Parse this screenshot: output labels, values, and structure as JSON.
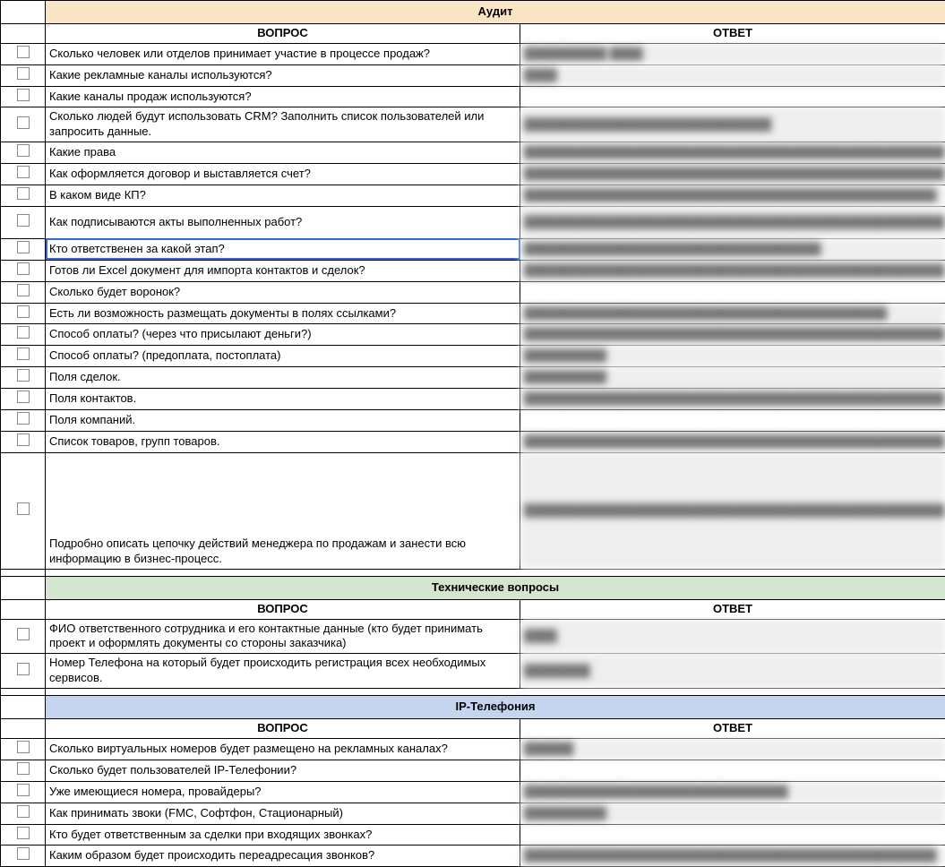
{
  "sections": [
    {
      "title": "Аудит",
      "headerClass": "sec-audit",
      "question_label": "ВОПРОС",
      "answer_label": "ОТВЕТ",
      "rows": [
        {
          "q": "Сколько человек или отделов принимает участие в процессе продаж?",
          "a": "██████████ ████"
        },
        {
          "q": "Какие рекламные каналы используются?",
          "a": "████"
        },
        {
          "q": "Какие каналы продаж используются?",
          "a": ""
        },
        {
          "q": "Сколько людей будут использовать CRM? Заполнить список пользователей или запросить данные.",
          "a": "██████████████████████████████"
        },
        {
          "q": "Какие права",
          "a": "████████████████████████████████████████████████████"
        },
        {
          "q": "Как оформляется договор и выставляется счет?",
          "a": "████████████████████████████████████████████████████████████"
        },
        {
          "q": "В каком виде КП?",
          "a": "██████████████████████████████████████████████████"
        },
        {
          "q": "Как подписываются акты выполненных работ?",
          "a": "██████████████████████████████████████████████████████████████████████████████████████████████████████████████",
          "tall": true
        },
        {
          "q": "Кто ответственен за какой этап?",
          "a": "████████████████████████████████████",
          "selected": true
        },
        {
          "q": "Готов ли Excel документ для импорта контактов и сделок?",
          "a": "████████████████████████████████████████████████████████████"
        },
        {
          "q": "Сколько будет воронок?",
          "a": ""
        },
        {
          "q": "Есть ли возможность размещать документы в полях ссылками?",
          "a": "████████████████████████████████████████████"
        },
        {
          "q": "Способ оплаты? (через что присылают деньги?)",
          "a": "████████████████████████████████████████████████████████████████████████████████"
        },
        {
          "q": "Способ оплаты? (предоплата, постоплата)",
          "a": "██████████"
        },
        {
          "q": "Поля сделок.",
          "a": "██████████"
        },
        {
          "q": "Поля контактов.",
          "a": "██████████████████████████████████████████████████████████████████████████████████████████████████████████████████████████████"
        },
        {
          "q": "Поля компаний.",
          "a": ""
        },
        {
          "q": "Список товаров, групп товаров.",
          "a": "████████████████████████████████████████████████████████████████████████████████████████████████████████████████████████████████████████████████████████████████████████████"
        },
        {
          "q": "Подробно описать цепочку действий менеджера по продажам и занести всю информацию в бизнес-процесс.",
          "a": "████████████████████████████████████████████████████████████████████████████████████████████████████████████████████████████████████████████████████████████████████████████████████████████████████████████████████████████████████████████████████████████████████████████████████████████████████████████████████████████████████████████████████████████████████████████████████████████████████████████████████████████████████████████████████████████████████████████████████████████████████████████████████████████████████████████████████████████████████████████████████████████████████████████████████████████████████████████████████████████████████████████████████████████████████████████████████████████████████████████████████████████████████████████████████████████████████████████████████████████████████████████████████████████████████████████████████████████████████████████████████████████████████████████████████████████████████████████████████████████████████████████████████████████████████████████████████████████████████████████████████████████████",
          "verytall": true
        }
      ]
    },
    {
      "title": "Технические вопросы",
      "headerClass": "sec-tech",
      "question_label": "ВОПРОС",
      "answer_label": "ОТВЕТ",
      "rows": [
        {
          "q": "ФИО ответственного сотрудника и его контактные данные (кто будет принимать проект и оформлять документы со стороны заказчика)",
          "a": "████"
        },
        {
          "q": "Номер Телефона на который будет происходить регистрация всех необходимых сервисов.",
          "a": "████████"
        }
      ]
    },
    {
      "title": "IP-Телефония",
      "headerClass": "sec-ip",
      "question_label": "ВОПРОС",
      "answer_label": "ОТВЕТ",
      "rows": [
        {
          "q": "Сколько виртуальных номеров будет размещено на рекламных каналах?",
          "a": "██████"
        },
        {
          "q": "Сколько будет пользователей IP-Телефонии?",
          "a": ""
        },
        {
          "q": "Уже имеющиеся номера, провайдеры?",
          "a": "████████████████████████████████"
        },
        {
          "q": "Как принимать звоки (FMC, Софтфон, Стационарный)",
          "a": "██████████"
        },
        {
          "q": "Кто будет ответственным за сделки при входящих звонках?",
          "a": ""
        },
        {
          "q": "Каким образом будет происходить переадресация звонков?",
          "a": "██████████████████████████████████████████████████"
        }
      ]
    }
  ]
}
